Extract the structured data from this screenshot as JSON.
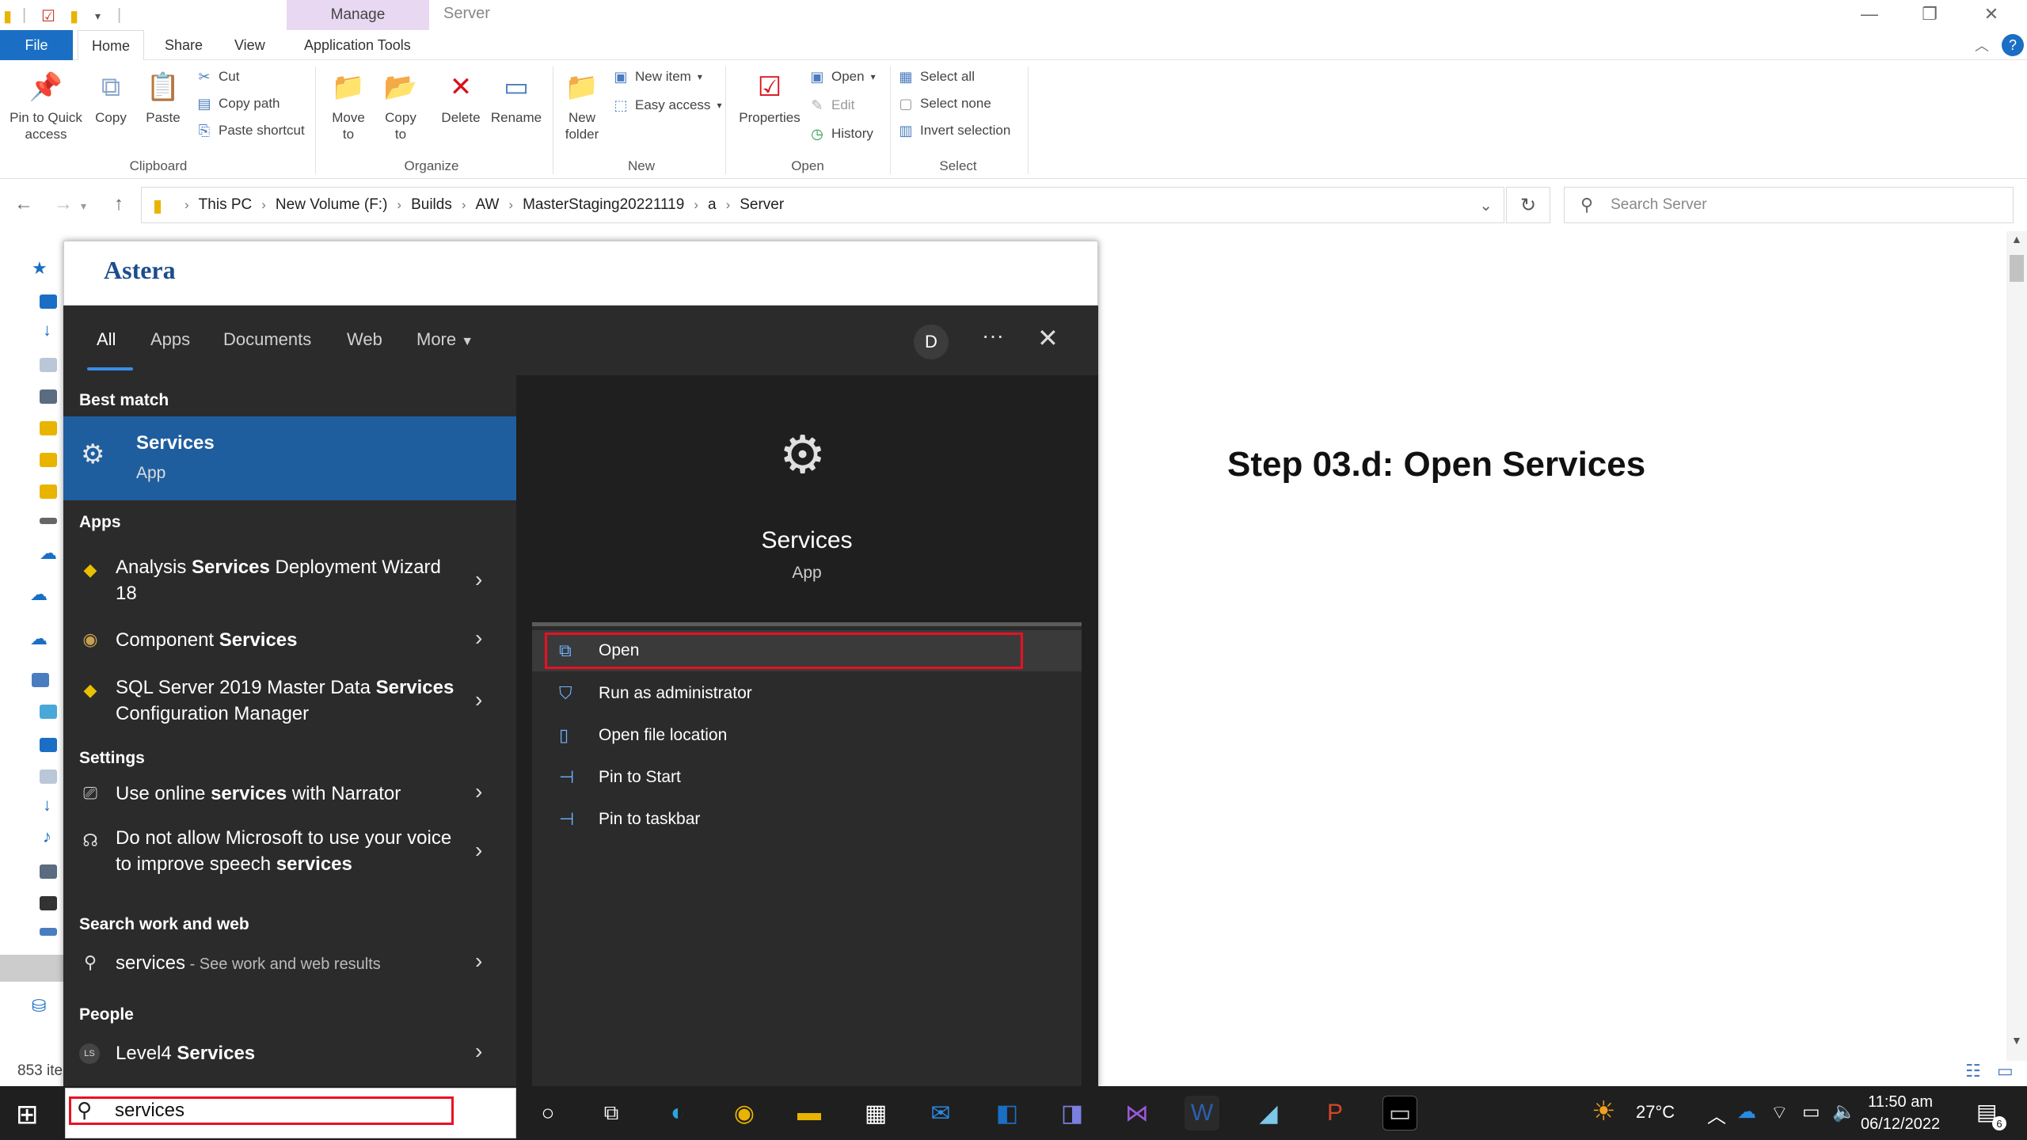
{
  "titlebar": {
    "manage_label": "Manage",
    "window_title": "Server"
  },
  "ribbon_tabs": {
    "file": "File",
    "home": "Home",
    "share": "Share",
    "view": "View",
    "application_tools": "Application Tools"
  },
  "ribbon": {
    "pin_quick": "Pin to Quick access",
    "copy": "Copy",
    "paste": "Paste",
    "cut": "Cut",
    "copy_path": "Copy path",
    "paste_shortcut": "Paste shortcut",
    "clipboard_group": "Clipboard",
    "move_to": "Move to",
    "copy_to": "Copy to",
    "delete": "Delete",
    "rename": "Rename",
    "organize_group": "Organize",
    "new_folder": "New folder",
    "new_item": "New item",
    "easy_access": "Easy access",
    "new_group": "New",
    "properties": "Properties",
    "open": "Open",
    "edit": "Edit",
    "history": "History",
    "open_group": "Open",
    "select_all": "Select all",
    "select_none": "Select none",
    "invert_selection": "Invert selection",
    "select_group": "Select"
  },
  "address": {
    "crumbs": [
      "This PC",
      "New Volume (F:)",
      "Builds",
      "AW",
      "MasterStaging20221119",
      "a",
      "Server"
    ],
    "search_placeholder": "Search Server"
  },
  "status": {
    "items_text": "853 ite"
  },
  "step_text": "Step 03.d: Open Services",
  "menu": {
    "logo": "Astera",
    "tabs": {
      "all": "All",
      "apps": "Apps",
      "documents": "Documents",
      "web": "Web",
      "more": "More"
    },
    "avatar_letter": "D",
    "headers": {
      "best_match": "Best match",
      "apps": "Apps",
      "settings": "Settings",
      "search_web": "Search work and web",
      "people": "People"
    },
    "best": {
      "title": "Services",
      "subtitle": "App"
    },
    "apps": [
      {
        "pre": "Analysis ",
        "bold": "Services",
        "post": " Deployment Wizard 18"
      },
      {
        "pre": "Component ",
        "bold": "Services",
        "post": ""
      },
      {
        "pre": "SQL Server 2019 Master Data ",
        "bold": "Services",
        "post": " Configuration Manager"
      }
    ],
    "settings": [
      {
        "pre": "Use online ",
        "bold": "services",
        "post": " with Narrator"
      },
      {
        "pre": "Do not allow Microsoft to use your voice to improve speech ",
        "bold": "services",
        "post": ""
      }
    ],
    "web": {
      "term": "services",
      "hint": " - See work and web results"
    },
    "people": {
      "initials": "LS",
      "pre": "Level4 ",
      "bold": "Services"
    },
    "preview": {
      "title": "Services",
      "subtitle": "App",
      "actions": [
        "Open",
        "Run as administrator",
        "Open file location",
        "Pin to Start",
        "Pin to taskbar"
      ]
    }
  },
  "taskbar": {
    "search_value": "services",
    "temperature": "27°C",
    "time": "11:50 am",
    "date": "06/12/2022",
    "notification_count": "6"
  }
}
